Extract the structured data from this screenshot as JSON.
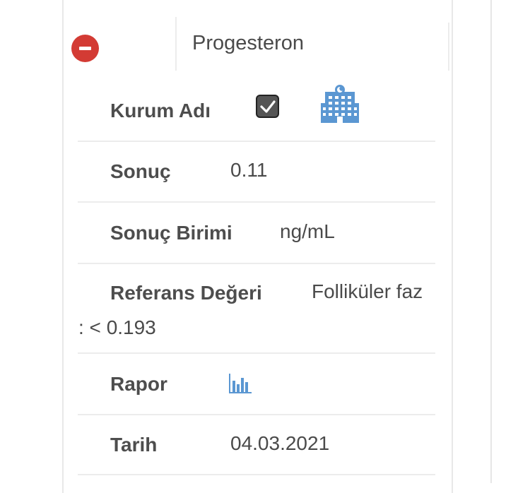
{
  "result": {
    "test_name": "Progesteron",
    "fields": {
      "institution": {
        "label": "Kurum Adı",
        "checked": true,
        "icon": "hospital-icon"
      },
      "result": {
        "label": "Sonuç",
        "value": "0.11"
      },
      "unit": {
        "label": "Sonuç Birimi",
        "value": "ng/mL"
      },
      "reference": {
        "label": "Referans Değeri",
        "value_line1": "Folliküler faz",
        "value_line2": ": < 0.193"
      },
      "report": {
        "label": "Rapor",
        "icon": "bar-chart-icon"
      },
      "date": {
        "label": "Tarih",
        "value": "04.03.2021"
      }
    }
  },
  "colors": {
    "remove": "#d33b34",
    "icon_blue": "#5b97d2",
    "text": "#4a4a4a",
    "divider": "#ececec"
  }
}
